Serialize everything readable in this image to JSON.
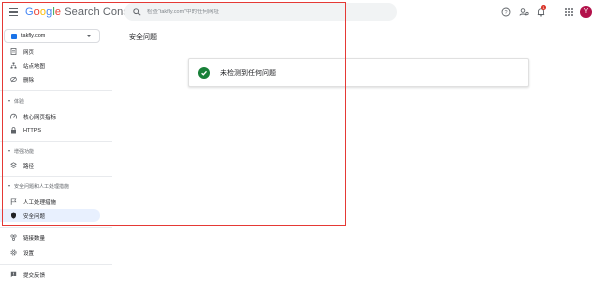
{
  "header": {
    "logo": {
      "g1": "G",
      "g2": "o",
      "g3": "o",
      "g4": "g",
      "g5": "l",
      "g6": "e",
      "product": "Search Console"
    },
    "search_placeholder": "检查“takfly.com”中的任何网址",
    "bell_badge": "1",
    "avatar_letter": "Y"
  },
  "sidebar": {
    "property_name": "takfly.com",
    "items": [
      {
        "label": "网页",
        "icon": "doc-icon"
      },
      {
        "label": "站点地图",
        "icon": "sitemap-icon"
      },
      {
        "label": "删除",
        "icon": "remove-icon"
      }
    ],
    "experience": {
      "section_label": "体验",
      "items": [
        {
          "label": "核心网页指标",
          "icon": "speed-icon"
        },
        {
          "label": "HTTPS",
          "icon": "lock-icon"
        }
      ]
    },
    "enhancements": {
      "section_label": "增强功能",
      "items": [
        {
          "label": "路径",
          "icon": "layers-icon"
        }
      ]
    },
    "security": {
      "section_label": "安全问题和人工处理措施",
      "items": [
        {
          "label": "人工处理措施",
          "icon": "flag-icon"
        },
        {
          "label": "安全问题",
          "icon": "shield-icon"
        }
      ]
    },
    "bottom_items": [
      {
        "label": "链接数量",
        "icon": "links-icon"
      },
      {
        "label": "设置",
        "icon": "settings-icon"
      },
      {
        "label": "提交反馈",
        "icon": "feedback-icon"
      }
    ]
  },
  "main": {
    "page_title": "安全问题",
    "status_message": "未检测到任何问题"
  },
  "colors": {
    "accent": "#1a73e8",
    "active_bg": "#e8f0fe",
    "success": "#188038",
    "highlight_frame": "#e53935"
  }
}
